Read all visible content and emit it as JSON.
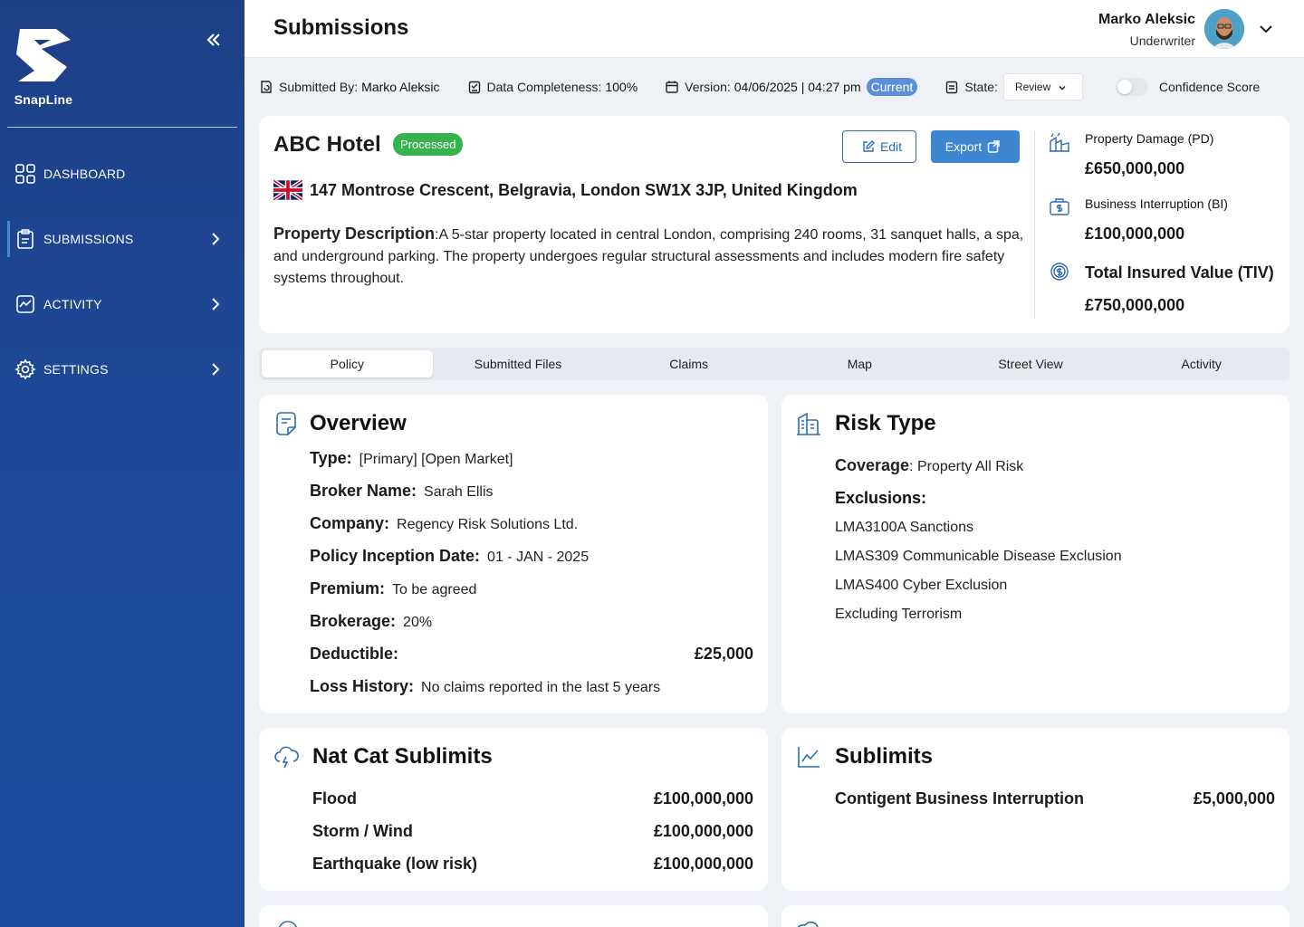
{
  "app": {
    "name": "SnapLine"
  },
  "sidebar": {
    "items": [
      {
        "label": "DASHBOARD"
      },
      {
        "label": "SUBMISSIONS"
      },
      {
        "label": "ACTIVITY"
      },
      {
        "label": "SETTINGS"
      }
    ]
  },
  "header": {
    "title": "Submissions",
    "user_name": "Marko Aleksic",
    "user_role": "Underwriter"
  },
  "infobar": {
    "submitted_by_label": "Submitted By:",
    "submitted_by_value": "Marko Aleksic",
    "completeness_label": "Data Completeness:",
    "completeness_value": "100%",
    "version_label": "Version:",
    "version_value": "04/06/2025 | 04:27 pm",
    "version_badge": "Current",
    "state_label": "State:",
    "state_value": "Review",
    "confidence_label": "Confidence Score"
  },
  "property": {
    "name": "ABC Hotel",
    "status": "Processed",
    "edit_label": "Edit",
    "export_label": "Export",
    "address": "147 Montrose Crescent, Belgravia, London SW1X 3JP, United Kingdom",
    "description_label": "Property Description",
    "description_text": ":A 5-star property located in central London, comprising 240 rooms, 31 sanquet halls, a spa, and underground parking. The property undergoes regular structural assessments and includes modern fire safety systems throughout."
  },
  "metrics": [
    {
      "label": "Property Damage (PD)",
      "value": "£650,000,000"
    },
    {
      "label": "Business Interruption (BI)",
      "value": "£100,000,000"
    },
    {
      "label": "Total Insured Value (TIV)",
      "value": "£750,000,000"
    }
  ],
  "tabs": [
    "Policy",
    "Submitted Files",
    "Claims",
    "Map",
    "Street View",
    "Activity"
  ],
  "overview": {
    "title": "Overview",
    "fields": [
      {
        "k": "Type:",
        "v": "[Primary] [Open Market]"
      },
      {
        "k": "Broker Name:",
        "v": "Sarah Ellis"
      },
      {
        "k": "Company:",
        "v": "Regency Risk Solutions Ltd."
      },
      {
        "k": "Policy Inception Date:",
        "v": "01 - JAN - 2025"
      },
      {
        "k": "Premium:",
        "v": "To be agreed"
      },
      {
        "k": "Brokerage:",
        "v": "20%"
      }
    ],
    "deductible_label": "Deductible:",
    "deductible_value": "£25,000",
    "loss_label": "Loss History:",
    "loss_value": "No claims reported in the last 5 years"
  },
  "risk": {
    "title": "Risk Type",
    "coverage_label": "Coverage",
    "coverage_value": ": Property All Risk",
    "exclusions_label": "Exclusions:",
    "exclusions": [
      "LMA3100A Sanctions",
      "LMAS309 Communicable Disease Exclusion",
      "LMAS400 Cyber Exclusion",
      "Excluding Terrorism"
    ]
  },
  "natcat": {
    "title": "Nat Cat Sublimits",
    "rows": [
      {
        "k": "Flood",
        "v": "£100,000,000"
      },
      {
        "k": "Storm / Wind",
        "v": "£100,000,000"
      },
      {
        "k": "Earthquake (low risk)",
        "v": "£100,000,000"
      }
    ]
  },
  "sublimits": {
    "title": "Sublimits",
    "rows": [
      {
        "k": "Contigent Business Interruption",
        "v": "£5,000,000"
      }
    ]
  },
  "colors": {
    "sidebar": "#1d3f86",
    "accent": "#3e86cf",
    "success": "#37b24d",
    "current_badge": "#5b8fd8"
  }
}
